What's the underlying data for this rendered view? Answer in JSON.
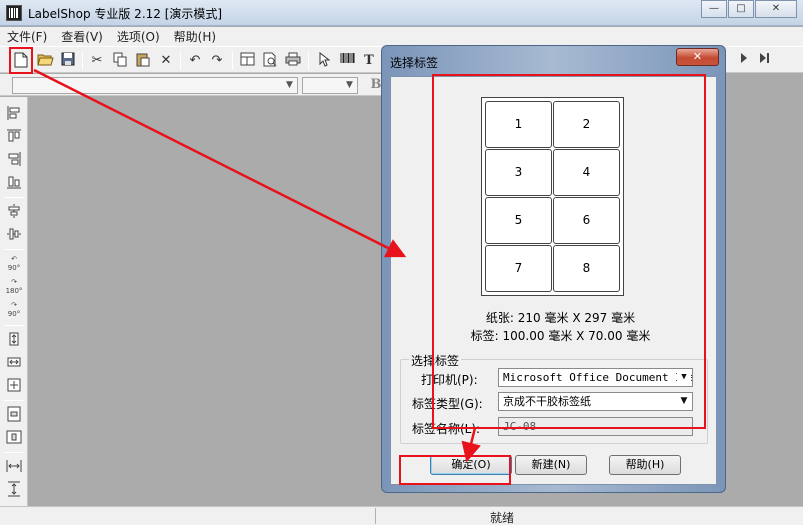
{
  "app": {
    "title": "LabelShop 专业版 2.12 [演示模式]",
    "window_buttons": {
      "minimize": "—",
      "maximize": "□",
      "close": "✕"
    }
  },
  "menubar": {
    "items": [
      {
        "label": "文件(F)"
      },
      {
        "label": "查看(V)"
      },
      {
        "label": "选项(O)"
      },
      {
        "label": "帮助(H)"
      }
    ]
  },
  "toolbar": {
    "icons": [
      "new-file-icon",
      "open-folder-icon",
      "save-icon",
      "cut-icon",
      "copy-icon",
      "paste-icon",
      "delete-icon",
      "undo-icon",
      "redo-icon",
      "page-setup-icon",
      "print-preview-icon",
      "print-icon",
      "pointer-icon",
      "barcode-icon",
      "text-icon"
    ]
  },
  "statusbar": {
    "text": "就绪"
  },
  "dialog": {
    "title": "选择标签",
    "close_label": "✕",
    "label_cells": [
      "1",
      "2",
      "3",
      "4",
      "5",
      "6",
      "7",
      "8"
    ],
    "paper_info": "纸张:  210 毫米 X  297 毫米",
    "label_info": "标签:  100.00 毫米 X 70.00 毫米",
    "group_title": "选择标签",
    "printer": {
      "label": "打印机(P):",
      "value": "Microsoft Office Document Ima"
    },
    "label_type": {
      "label": "标签类型(G):",
      "value": "京成不干胶标签纸"
    },
    "label_name": {
      "label": "标签名称(L):",
      "value": "JC-08"
    },
    "buttons": {
      "ok": "确定(O)",
      "new": "新建(N)",
      "help": "帮助(H)"
    }
  },
  "annotation_color": "#e8121b"
}
